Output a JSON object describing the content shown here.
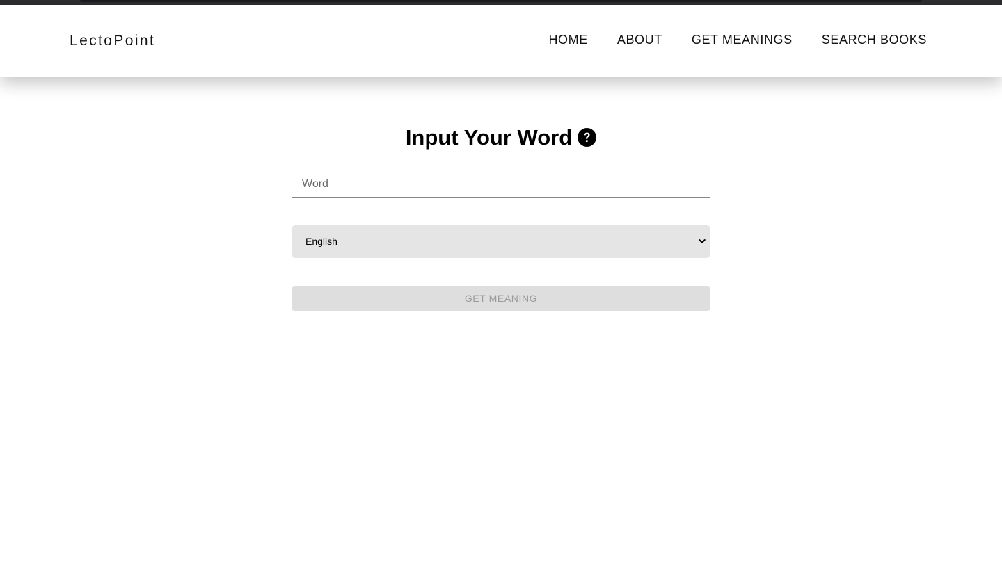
{
  "nav": {
    "brand": "LectoPoint",
    "links": [
      {
        "label": "HOME"
      },
      {
        "label": "ABOUT"
      },
      {
        "label": "GET MEANINGS"
      },
      {
        "label": "SEARCH BOOKS"
      }
    ]
  },
  "form": {
    "heading": "Input Your Word",
    "help_icon": "question-circle-icon",
    "word_input": {
      "placeholder": "Word",
      "value": ""
    },
    "language_select": {
      "selected": "English",
      "icon": "chevron-down-icon"
    },
    "submit_label": "GET MEANING",
    "submit_disabled": true
  },
  "colors": {
    "navbar_bg": "#ffffff",
    "select_bg": "#e5e5e5",
    "button_disabled_bg": "#dedede",
    "button_disabled_text": "#9a9a9a",
    "browser_topbar": "#2d2d30"
  }
}
